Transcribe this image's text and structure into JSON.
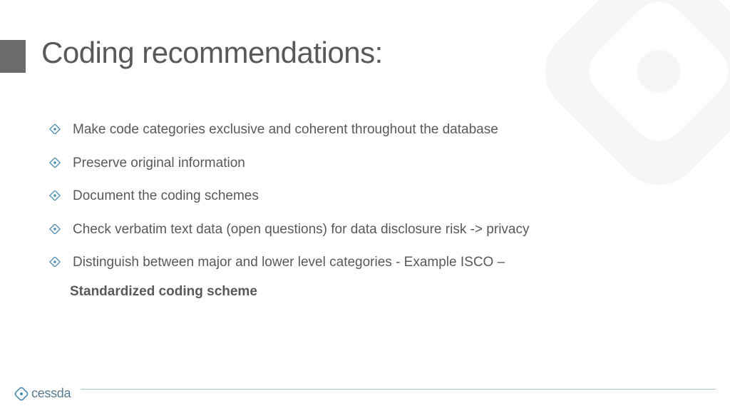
{
  "slide": {
    "title": "Coding recommendations:",
    "bullets": [
      "Make code categories exclusive and coherent throughout the database",
      "Preserve original information",
      "Document the coding schemes",
      "Check verbatim text data (open questions) for data disclosure risk -> privacy",
      "Distinguish between major and lower level categories - Example ISCO –"
    ],
    "bullet5_continuation": "Standardized coding scheme"
  },
  "footer": {
    "brand": "cessda"
  },
  "colors": {
    "bullet_outline": "#4a8bb0",
    "text": "#595959",
    "footer_accent": "#5c7a8f"
  }
}
